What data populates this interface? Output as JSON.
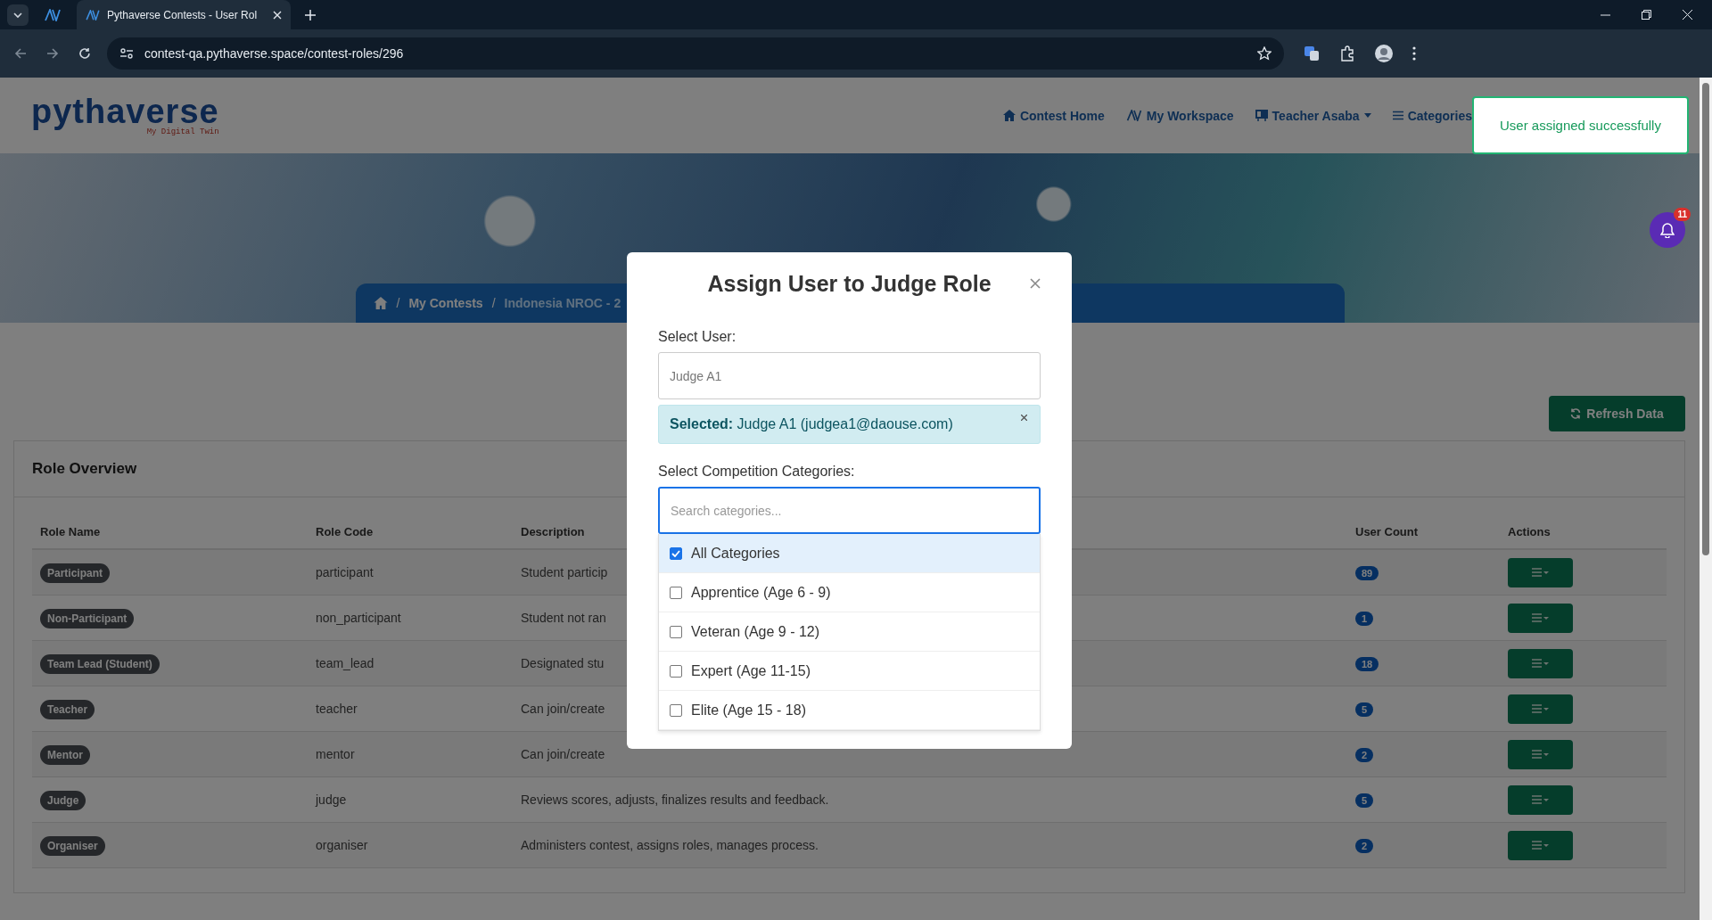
{
  "browser": {
    "tab_title": "Pythaverse Contests - User Rol",
    "url": "contest-qa.pythaverse.space/contest-roles/296"
  },
  "header": {
    "logo": "pythaverse",
    "tagline": "My Digital Twin",
    "nav": [
      {
        "label": "Contest Home",
        "kind": "home",
        "dropdown": false
      },
      {
        "label": "My Workspace",
        "kind": "workspace",
        "dropdown": false
      },
      {
        "label": "Teacher Asaba",
        "kind": "teacher",
        "dropdown": true
      },
      {
        "label": "Categories",
        "kind": "list",
        "dropdown": false
      }
    ]
  },
  "toast": {
    "message": "User assigned successfully"
  },
  "notifications": {
    "count": "11"
  },
  "breadcrumb": {
    "separator": "/",
    "items": [
      "My Contests",
      "Indonesia NROC - 2"
    ]
  },
  "refresh_button": "Refresh Data",
  "role_overview": {
    "title": "Role Overview",
    "columns": [
      "Role Name",
      "Role Code",
      "Description",
      "User Count",
      "Actions"
    ],
    "rows": [
      {
        "name": "Participant",
        "code": "participant",
        "description": "Student particip",
        "user_count": "89"
      },
      {
        "name": "Non-Participant",
        "code": "non_participant",
        "description": "Student not ran",
        "user_count": "1"
      },
      {
        "name": "Team Lead (Student)",
        "code": "team_lead",
        "description": "Designated stu",
        "user_count": "18"
      },
      {
        "name": "Teacher",
        "code": "teacher",
        "description": "Can join/create",
        "user_count": "5"
      },
      {
        "name": "Mentor",
        "code": "mentor",
        "description": "Can join/create",
        "user_count": "2"
      },
      {
        "name": "Judge",
        "code": "judge",
        "description": "Reviews scores, adjusts, finalizes results and feedback.",
        "user_count": "5"
      },
      {
        "name": "Organiser",
        "code": "organiser",
        "description": "Administers contest, assigns roles, manages process.",
        "user_count": "2"
      }
    ]
  },
  "modal": {
    "title": "Assign User to Judge Role",
    "user_label": "Select User:",
    "user_value": "Judge A1",
    "selected_label": "Selected:",
    "selected_value": "Judge A1 (judgea1@daouse.com)",
    "categories_label": "Select Competition Categories:",
    "search_placeholder": "Search categories...",
    "categories": [
      {
        "label": "All Categories",
        "checked": true
      },
      {
        "label": "Apprentice (Age 6 - 9)",
        "checked": false
      },
      {
        "label": "Veteran (Age 9 - 12)",
        "checked": false
      },
      {
        "label": "Expert (Age 11-15)",
        "checked": false
      },
      {
        "label": "Elite (Age 15 - 18)",
        "checked": false
      }
    ]
  }
}
